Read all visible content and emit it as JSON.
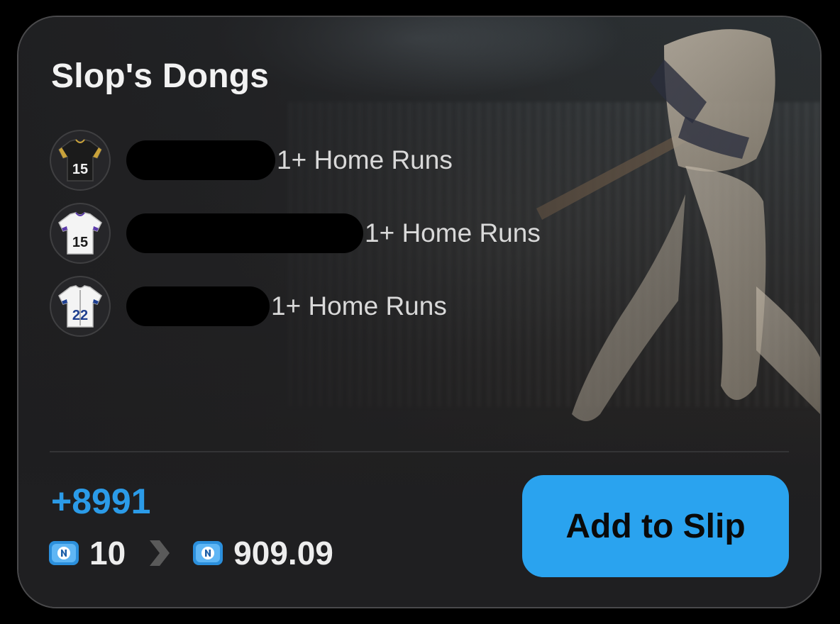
{
  "card": {
    "title": "Slop's Dongs"
  },
  "legs": [
    {
      "jersey_number": "15",
      "jersey_style": "black",
      "player_name": "",
      "market": "1+ Home Runs"
    },
    {
      "jersey_number": "15",
      "jersey_style": "white-purple",
      "player_name": "",
      "market": "1+ Home Runs"
    },
    {
      "jersey_number": "22",
      "jersey_style": "white-blue",
      "player_name": "",
      "market": "1+ Home Runs"
    }
  ],
  "summary": {
    "odds": "+8991",
    "stake": "10",
    "payout": "909.09"
  },
  "actions": {
    "add_to_slip": "Add to Slip"
  },
  "icons": {
    "coin": "coin-icon",
    "arrow": "chevron-right-icon",
    "jersey": "jersey-icon"
  },
  "colors": {
    "accent": "#2aa3ef",
    "odds": "#2b9be8",
    "card_bg": "#1f1f21"
  }
}
